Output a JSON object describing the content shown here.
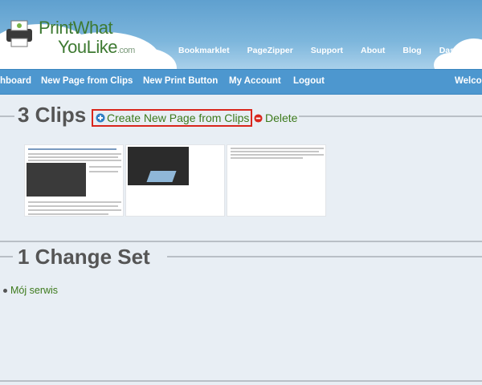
{
  "logo": {
    "line1": "PrintWhat",
    "line2": "YouLike",
    "suffix": ".com"
  },
  "top_nav": [
    "Bookmarklet",
    "PageZipper",
    "Support",
    "About",
    "Blog",
    "Dashboard"
  ],
  "sub_nav": {
    "dashboard": "hboard",
    "new_page": "New Page from Clips",
    "new_button": "New Print Button",
    "account": "My Account",
    "logout": "Logout",
    "welcome": "Welco"
  },
  "clips": {
    "title": "3 Clips",
    "create_label": "Create New Page from Clips",
    "delete_label": "Delete"
  },
  "change_sets": {
    "title": "1 Change Set",
    "items": [
      "Mój serwis"
    ]
  },
  "colors": {
    "accent": "#d9261c",
    "link": "#3d7a1c",
    "nav_bar": "#4d97cf"
  }
}
